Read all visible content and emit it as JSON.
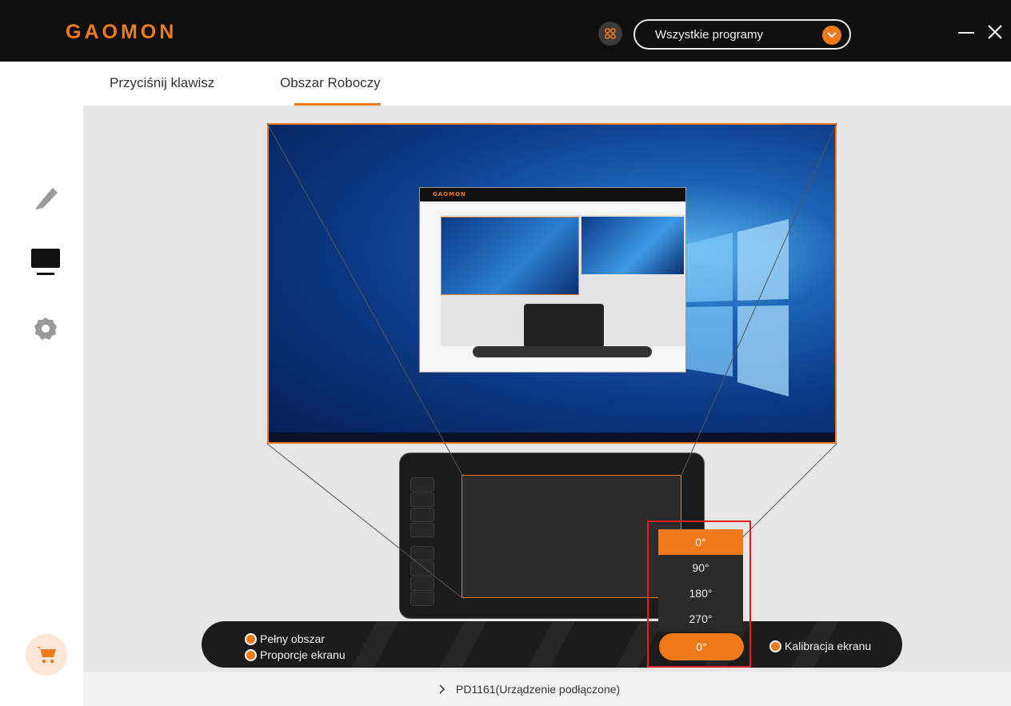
{
  "app": {
    "logo": "GAOMON",
    "program_select_value": "Wszystkie programy"
  },
  "tabs": [
    {
      "label": "Przyciśnij klawisz",
      "active": false
    },
    {
      "label": "Obszar Roboczy",
      "active": true
    }
  ],
  "sidebar": {
    "items": [
      {
        "icon": "pen-icon",
        "active": false
      },
      {
        "icon": "monitor-icon",
        "active": true
      },
      {
        "icon": "gear-icon",
        "active": false
      }
    ],
    "cart_icon": "cart-icon"
  },
  "controls": {
    "full_area_label": "Pełny obszar",
    "screen_ratio_label": "Proporcje ekranu",
    "calibration_label": "Kalibracja ekranu",
    "rotation_selected": "0°",
    "rotation_options": [
      "0°",
      "90°",
      "180°",
      "270°"
    ]
  },
  "footer": {
    "device_label": "PD1161(Urządzenie podłączone)"
  },
  "colors": {
    "accent": "#f07a1a",
    "titlebar": "#0f0f0f",
    "work_bg": "#e6e6e6",
    "highlight": "#e02020"
  }
}
